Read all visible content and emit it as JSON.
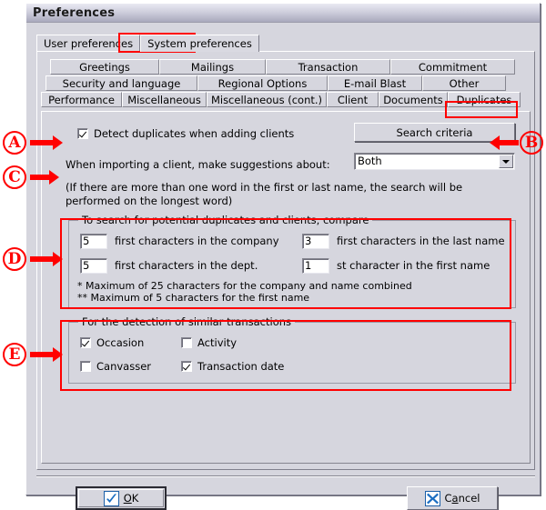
{
  "window": {
    "title": "Preferences"
  },
  "top_tabs": {
    "items": [
      {
        "label": "User preferences",
        "active": false
      },
      {
        "label": "System preferences",
        "active": true
      }
    ]
  },
  "sub_tabs": {
    "rows": [
      [
        {
          "label": "Greetings",
          "active": false
        },
        {
          "label": "Mailings",
          "active": false
        },
        {
          "label": "Transaction",
          "active": false
        },
        {
          "label": "Commitment",
          "active": false
        }
      ],
      [
        {
          "label": "Security and language",
          "active": false
        },
        {
          "label": "Regional Options",
          "active": false
        },
        {
          "label": "E-mail Blast",
          "active": false
        },
        {
          "label": "Other",
          "active": false
        }
      ],
      [
        {
          "label": "Performance",
          "active": false
        },
        {
          "label": "Miscellaneous",
          "active": false
        },
        {
          "label": "Miscellaneous (cont.)",
          "active": false
        },
        {
          "label": "Client",
          "active": false
        },
        {
          "label": "Documents",
          "active": false
        },
        {
          "label": "Duplicates",
          "active": true
        }
      ]
    ]
  },
  "panel": {
    "detect_duplicates": {
      "label": "Detect duplicates when adding clients",
      "checked": true
    },
    "search_criteria_button": "Search criteria",
    "import_label": "When importing a client, make suggestions about:",
    "suggestions_combo": {
      "value": "Both",
      "options": [
        "Both"
      ]
    },
    "longest_word_note": "(If there are more than one word in the first or last name, the search will be performed on the longest word)",
    "compare_group": {
      "title": "To search for potential duplicates and clients, compare",
      "fields": [
        {
          "value": "5",
          "label": "first characters in the company"
        },
        {
          "value": "3",
          "label": "first characters in the last name"
        },
        {
          "value": "5",
          "label": "first characters in the dept."
        },
        {
          "value": "1",
          "label": "st character in the first name"
        }
      ],
      "footnotes": [
        "* Maximum of 25 characters for the company and name combined",
        "** Maximum of 5 characters for the first name"
      ]
    },
    "transactions_group": {
      "title": "For the detection of similar transactions",
      "checkboxes": [
        {
          "label": "Occasion",
          "checked": true
        },
        {
          "label": "Activity",
          "checked": false
        },
        {
          "label": "Canvasser",
          "checked": false
        },
        {
          "label": "Transaction date",
          "checked": true
        }
      ]
    }
  },
  "footer": {
    "ok": {
      "pre": "",
      "accel": "O",
      "post": "K",
      "icon": "check-icon"
    },
    "cancel": {
      "pre": "C",
      "accel": "a",
      "post": "ncel",
      "icon": "x-icon"
    }
  },
  "annotations": {
    "a": "A",
    "b": "B",
    "c": "C",
    "d": "D",
    "e": "E"
  },
  "colors": {
    "annotation": "#ff0000",
    "face": "#d6d6de",
    "icon_blue": "#1b6ec2"
  }
}
